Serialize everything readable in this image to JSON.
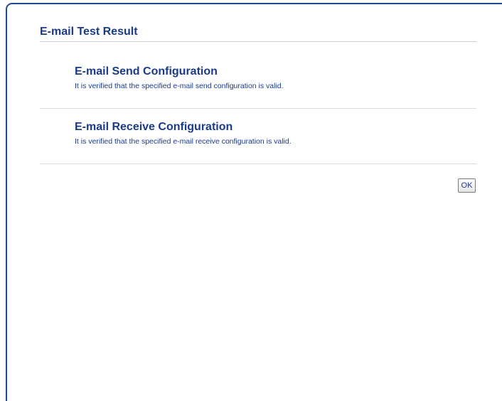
{
  "page": {
    "title": "E-mail Test Result"
  },
  "sections": [
    {
      "title": "E-mail Send Configuration",
      "message": "It is verified that the specified e-mail send configuration is valid."
    },
    {
      "title": "E-mail Receive Configuration",
      "message": "It is verified that the specified e-mail receive configuration is valid."
    }
  ],
  "actions": {
    "ok_label": "OK"
  },
  "colors": {
    "accent": "#1a3a8a",
    "frame": "#1c4d8f"
  }
}
